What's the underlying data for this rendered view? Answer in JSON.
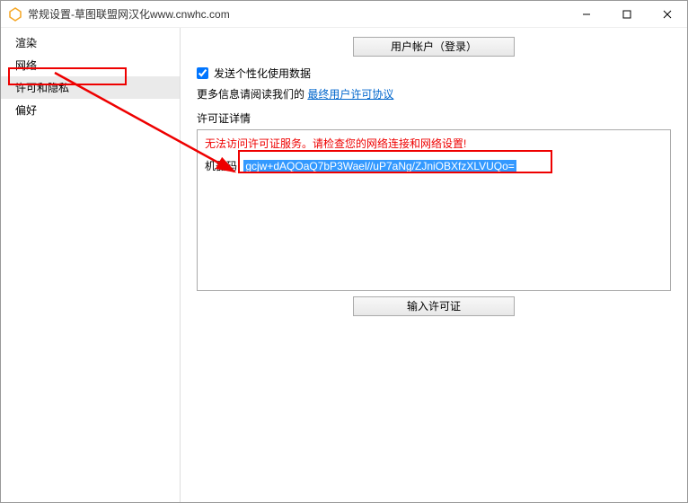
{
  "titlebar": {
    "title": "常规设置-草图联盟网汉化www.cnwhc.com"
  },
  "sidebar": {
    "items": [
      {
        "label": "渲染"
      },
      {
        "label": "网络"
      },
      {
        "label": "许可和隐私"
      },
      {
        "label": "偏好"
      }
    ],
    "selected_index": 2
  },
  "content": {
    "user_account_btn": "用户帐户（登录）",
    "send_data_label": "发送个性化使用数据",
    "more_info_prefix": "更多信息请阅读我们的 ",
    "eula_link": "最终用户许可协议",
    "license_details_label": "许可证详情",
    "error_text": "无法访问许可证服务。请检查您的网络连接和网络设置!",
    "machine_code_label": "机器码:",
    "machine_code_value": "gcjw+dAQOaQ7bP3Wael//uP7aNg/ZJniOBXfzXLVUQo=",
    "enter_license_btn": "输入许可证"
  }
}
